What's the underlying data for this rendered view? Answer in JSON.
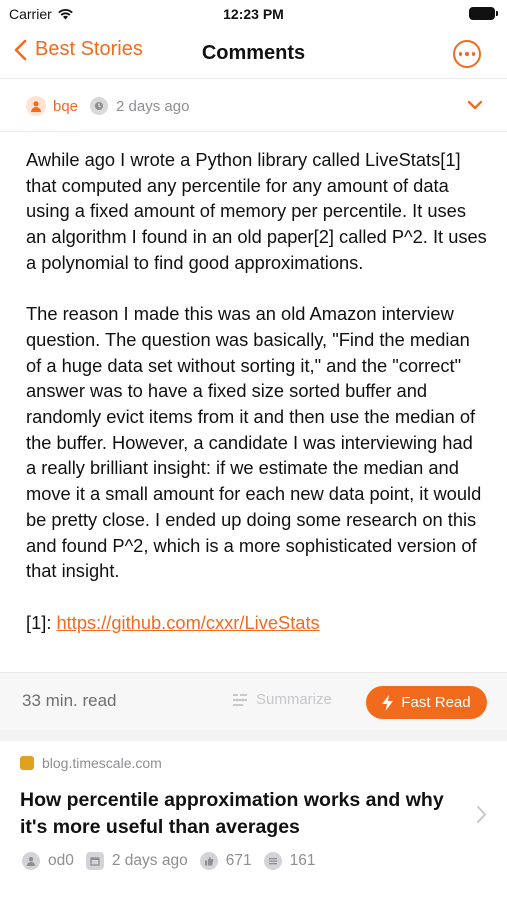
{
  "status_bar": {
    "carrier": "Carrier",
    "time": "12:23 PM"
  },
  "nav": {
    "back_label": "Best Stories",
    "title": "Comments"
  },
  "comment": {
    "author": "bqe",
    "age": "2 days ago",
    "paragraphs": [
      "Awhile ago I wrote a Python library called LiveStats[1] that computed any percentile for any amount of data using a fixed amount of memory per percentile. It uses an algorithm I found in an old paper[2] called P^2. It uses a polynomial to find good approximations.",
      "The reason I made this was an old Amazon interview question. The question was basically, \"Find the median of a huge data set without sorting it,\" and the \"correct\" answer was to have a fixed size sorted buffer and randomly evict items from it and then use the median of the buffer. However, a candidate I was interviewing had a really brilliant insight: if we estimate the median and move it a small amount for each new data point, it would be pretty close. I ended up doing some research on this and found P^2, which is a more sophisticated version of that insight."
    ],
    "footnote_label": "[1]:",
    "footnote_link": "https://github.com/cxxr/LiveStats"
  },
  "actions": {
    "read_time": "33 min. read",
    "summarize_label": "Summarize",
    "fast_read_label": "Fast Read"
  },
  "story": {
    "domain": "blog.timescale.com",
    "title": "How percentile approximation works and why it's more useful than averages",
    "author": "od0",
    "age": "2 days ago",
    "points": "671",
    "comments": "161"
  },
  "colors": {
    "accent": "#f26b1d",
    "secondary_text": "#8e8e93"
  },
  "icons": [
    "wifi-icon",
    "battery-icon",
    "chevron-left-icon",
    "more-icon",
    "user-icon",
    "clock-icon",
    "chevron-down-icon",
    "summarize-icon",
    "bolt-icon",
    "favicon-icon",
    "chevron-right-icon",
    "thumbs-up-icon",
    "comments-icon"
  ]
}
